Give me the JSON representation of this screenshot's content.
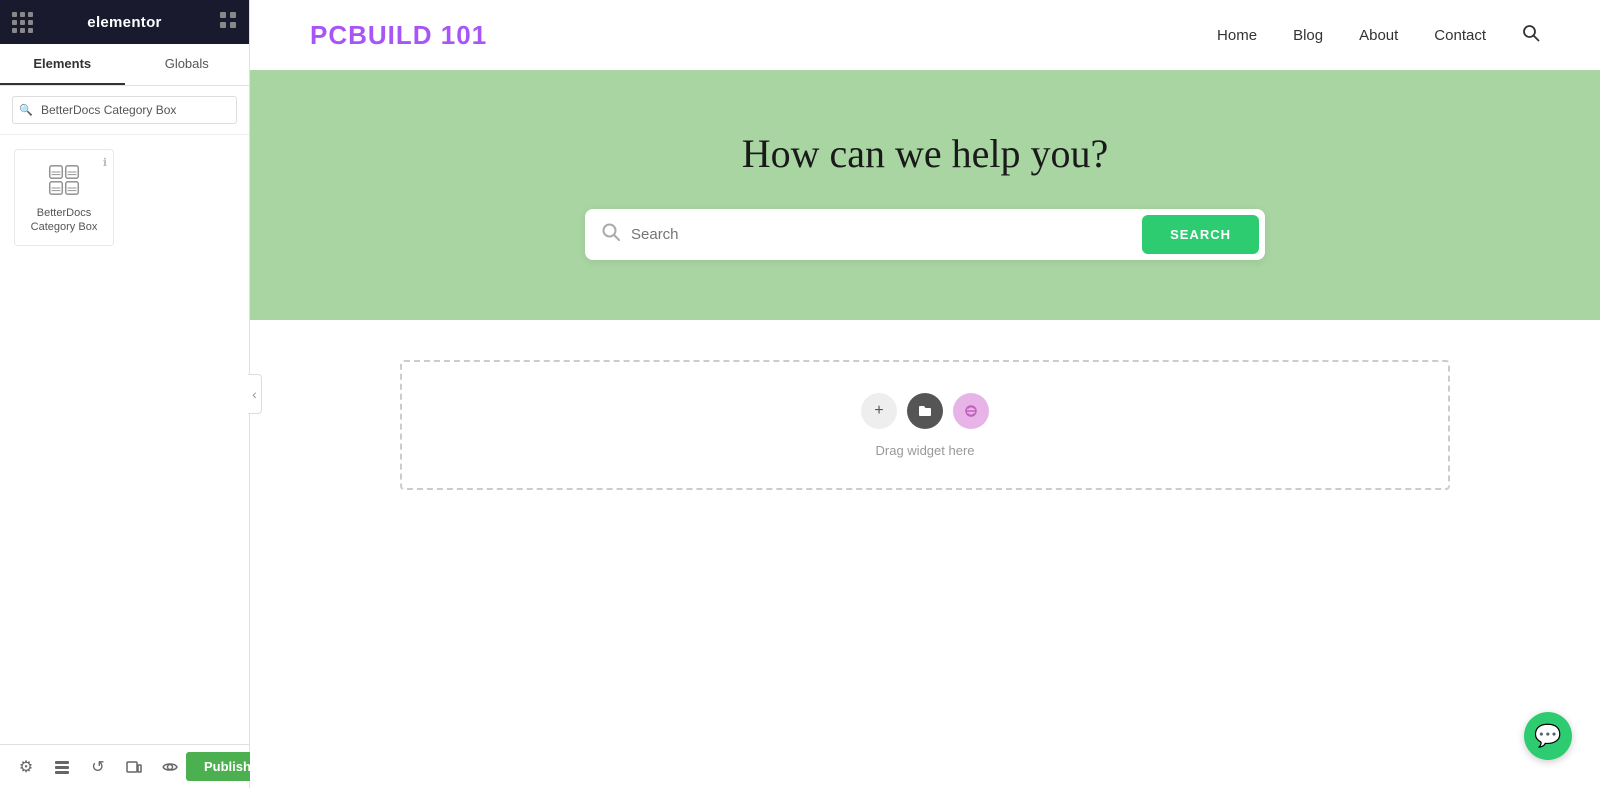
{
  "elementor": {
    "header": {
      "logo": "elementor",
      "grid_icon_label": "grid-icon"
    },
    "tabs": [
      {
        "id": "elements",
        "label": "Elements",
        "active": true
      },
      {
        "id": "globals",
        "label": "Globals",
        "active": false
      }
    ],
    "search": {
      "placeholder": "BetterDocs Category Box",
      "value": "BetterDocs Category Box"
    },
    "widgets": [
      {
        "id": "betterdocs-category-box",
        "label": "BetterDocs Category Box",
        "icon": "grid-widget-icon"
      }
    ],
    "bottom_tools": [
      {
        "id": "settings",
        "icon": "⚙",
        "label": "settings-icon"
      },
      {
        "id": "layers",
        "icon": "☰",
        "label": "layers-icon"
      },
      {
        "id": "history",
        "icon": "↺",
        "label": "history-icon"
      },
      {
        "id": "responsive",
        "icon": "⬚",
        "label": "responsive-icon"
      },
      {
        "id": "preview",
        "icon": "👁",
        "label": "preview-icon"
      }
    ],
    "publish_button": "Publish",
    "publish_arrow": "▲"
  },
  "site": {
    "logo": "PCBUILD 101",
    "nav_links": [
      {
        "label": "Home",
        "href": "#"
      },
      {
        "label": "Blog",
        "href": "#"
      },
      {
        "label": "About",
        "href": "#"
      },
      {
        "label": "Contact",
        "href": "#"
      }
    ],
    "hero": {
      "title": "How can we help you?",
      "search_placeholder": "Search",
      "search_button": "SEARCH",
      "background_color": "#a8d5a2"
    },
    "empty_section": {
      "drag_hint": "Drag widget here"
    }
  },
  "chat_button": {
    "icon": "💬"
  }
}
